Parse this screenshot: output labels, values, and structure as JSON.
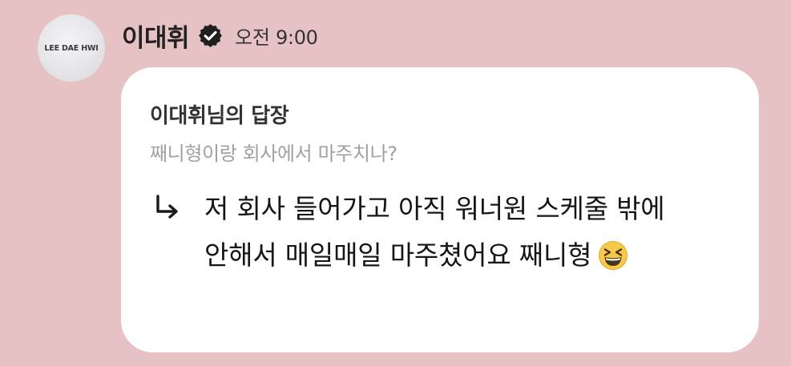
{
  "post": {
    "avatar_text": "LEE DAE HWI",
    "author_name": "이대휘",
    "verified_icon": "verified-badge-icon",
    "timestamp": "오전 9:00",
    "reply_title": "이대휘님의 답장",
    "quoted_message": "째니형이랑 회사에서 마주치나?",
    "reply_icon": "reply-arrow-icon",
    "message": "저 회사 들어가고 아직 워너원 스케줄 밖에 안해서 매일매일 마주쳤어요 째니형",
    "emoji": "grinning-squinting-face-icon"
  },
  "colors": {
    "background": "#e7c2c4",
    "bubble": "#ffffff",
    "quoted_text": "#a1a1a1",
    "emoji_yellow": "#f7c94a"
  }
}
